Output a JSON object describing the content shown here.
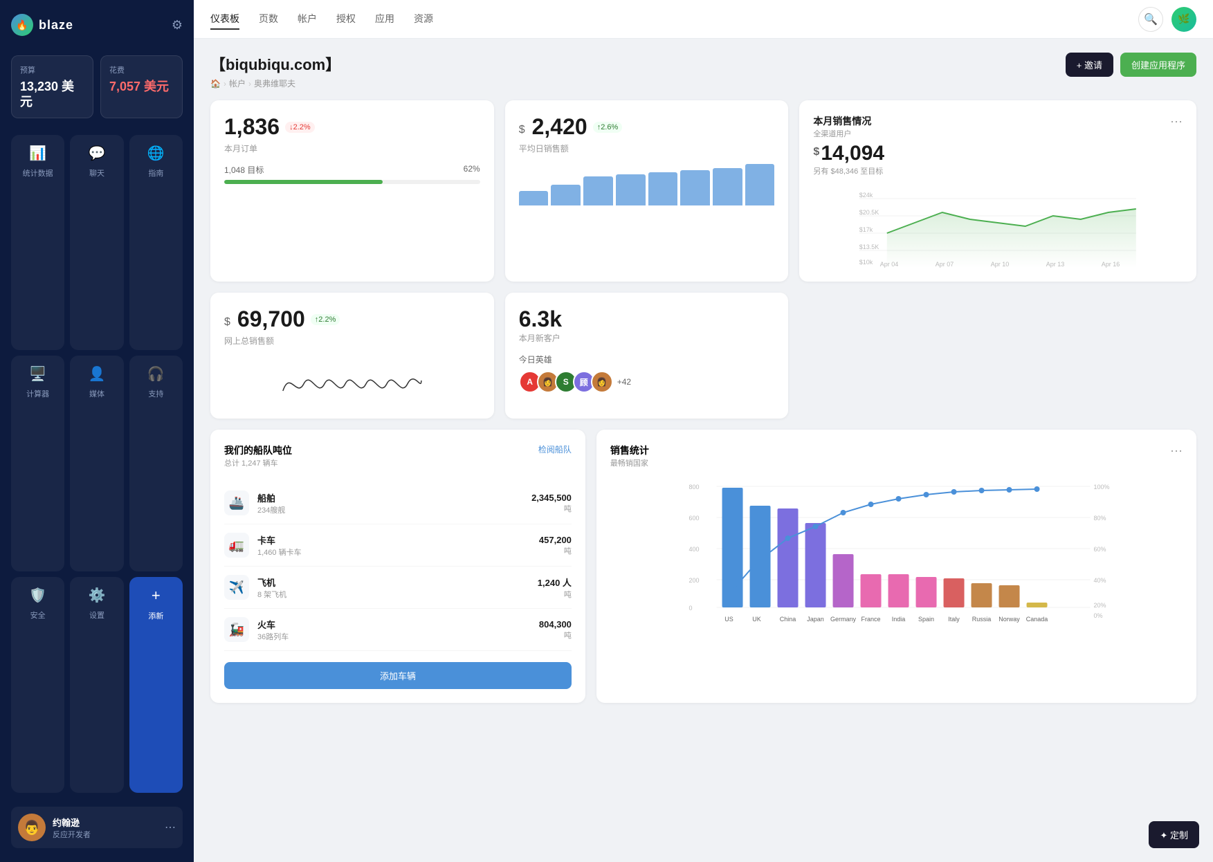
{
  "sidebar": {
    "logo_text": "blaze",
    "budget": {
      "label": "预算",
      "value": "13,230 美元"
    },
    "spending": {
      "label": "花费",
      "value": "7,057 美元"
    },
    "nav_items": [
      {
        "id": "stats",
        "label": "统计数据",
        "icon": "📊",
        "active": false
      },
      {
        "id": "chat",
        "label": "聊天",
        "icon": "💬",
        "active": false
      },
      {
        "id": "guide",
        "label": "指南",
        "icon": "🌐",
        "active": false
      },
      {
        "id": "calc",
        "label": "计算器",
        "icon": "🖥️",
        "active": false
      },
      {
        "id": "media",
        "label": "媒体",
        "icon": "👤",
        "active": false
      },
      {
        "id": "support",
        "label": "支持",
        "icon": "🎧",
        "active": false
      },
      {
        "id": "security",
        "label": "安全",
        "icon": "🛡️",
        "active": false
      },
      {
        "id": "settings",
        "label": "设置",
        "icon": "⚙️",
        "active": false
      },
      {
        "id": "add",
        "label": "添新",
        "icon": "+",
        "active": true
      }
    ],
    "user": {
      "name": "约翰逊",
      "role": "反应开发者"
    }
  },
  "top_nav": {
    "items": [
      {
        "label": "仪表板",
        "active": true
      },
      {
        "label": "页数",
        "active": false
      },
      {
        "label": "帐户",
        "active": false
      },
      {
        "label": "授权",
        "active": false
      },
      {
        "label": "应用",
        "active": false
      },
      {
        "label": "资源",
        "active": false
      }
    ]
  },
  "page": {
    "title": "【biqubiqu.com】",
    "breadcrumb": [
      "🏠",
      "帐户",
      "奥弗维耶夫"
    ],
    "btn_invite": "+ 邀请",
    "btn_create": "创建应用程序"
  },
  "stats": {
    "orders": {
      "value": "1,836",
      "badge": "↓2.2%",
      "badge_type": "down",
      "label": "本月订单",
      "progress_label": "1,048 目标",
      "progress_pct": "62%",
      "progress_value": 62
    },
    "avg_sales": {
      "dollar": "$",
      "value": "2,420",
      "badge": "↑2.6%",
      "badge_type": "up",
      "label": "平均日销售额"
    },
    "monthly_sales": {
      "title": "本月销售情况",
      "subtitle": "全渠道用户",
      "dollar": "$",
      "value": "14,094",
      "target": "另有 $48,346 至目标",
      "x_labels": [
        "Apr 04",
        "Apr 07",
        "Apr 10",
        "Apr 13",
        "Apr 16"
      ],
      "y_labels": [
        "$24k",
        "$20.5K",
        "$17k",
        "$13.5K",
        "$10k"
      ]
    },
    "total_sales": {
      "dollar": "$",
      "value": "69,700",
      "badge": "↑2.2%",
      "badge_type": "up",
      "label": "网上总销售额"
    },
    "new_customers": {
      "value": "6.3k",
      "label": "本月新客户"
    },
    "heroes": {
      "label": "今日英雄",
      "count": "+42"
    }
  },
  "fleet": {
    "title": "我们的船队吨位",
    "subtitle": "总计 1,247 辆车",
    "link": "检阅船队",
    "items": [
      {
        "icon": "🚢",
        "name": "船舶",
        "sub": "234艘舰",
        "value": "2,345,500",
        "unit": "吨"
      },
      {
        "icon": "🚛",
        "name": "卡车",
        "sub": "1,460 辆卡车",
        "value": "457,200",
        "unit": "吨"
      },
      {
        "icon": "✈️",
        "name": "飞机",
        "sub": "8 架飞机",
        "value": "1,240 人",
        "unit": "吨"
      },
      {
        "icon": "🚂",
        "name": "火车",
        "sub": "36路列车",
        "value": "804,300",
        "unit": "吨"
      }
    ],
    "add_btn": "添加车辆"
  },
  "sales_stats": {
    "title": "销售统计",
    "subtitle": "最畅销国家",
    "countries": [
      "US",
      "UK",
      "China",
      "Japan",
      "Germany",
      "France",
      "India",
      "Spain",
      "Italy",
      "Russia",
      "Norway",
      "Canada"
    ],
    "values": [
      720,
      610,
      595,
      510,
      320,
      200,
      200,
      185,
      175,
      145,
      130,
      30
    ],
    "colors": [
      "#4a90d9",
      "#4a90d9",
      "#7c6fdf",
      "#7c6fdf",
      "#b565c9",
      "#e86ab0",
      "#e86ab0",
      "#e86ab0",
      "#d96060",
      "#c4874a",
      "#c4874a",
      "#d4b84a"
    ],
    "pct_labels": [
      "100%",
      "80%",
      "60%",
      "40%",
      "20%",
      "0%"
    ],
    "y_labels": [
      "800",
      "600",
      "400",
      "200",
      "0"
    ]
  },
  "customize_btn": "✦ 定制"
}
